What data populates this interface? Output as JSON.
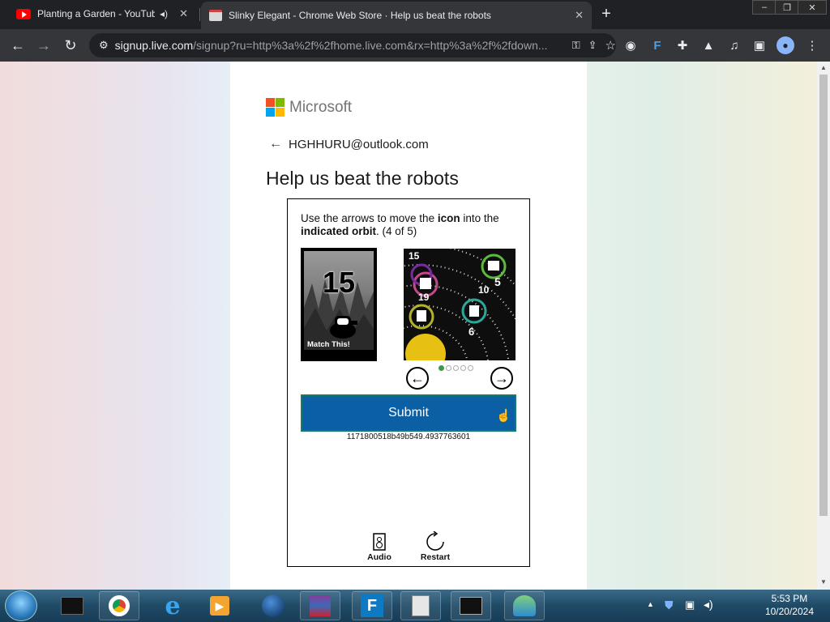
{
  "browser": {
    "tabs": [
      {
        "title": "Planting a Garden - YouTube",
        "audio": true
      },
      {
        "title": "Slinky Elegant - Chrome Web Store · Help us beat the robots",
        "active": true
      }
    ],
    "new_tab_symbol": "+",
    "url_domain": "signup.live.com",
    "url_rest": "/signup?ru=http%3a%2f%2fhome.live.com&rx=http%3a%2f%2fdown..."
  },
  "page": {
    "brand": "Microsoft",
    "email": "HGHHURU@outlook.com",
    "heading": "Help us beat the robots",
    "captcha": {
      "instr_pre": "Use the arrows to move the ",
      "instr_bold1": "icon",
      "instr_mid": " into the ",
      "instr_bold2": "indicated orbit",
      "instr_post": ". (4 of 5)",
      "match_number": "15",
      "match_label": "Match This!",
      "orbit_numbers": [
        "15",
        "19",
        "10",
        "5",
        "6"
      ],
      "dots_total": 5,
      "dots_active": 1,
      "submit_label": "Submit",
      "session_id": "1171800518b49b549.4937763601",
      "audio_label": "Audio",
      "restart_label": "Restart"
    }
  },
  "taskbar": {
    "time": "5:53 PM",
    "date": "10/20/2024"
  },
  "colors": {
    "submit_bg": "#0b5fa5",
    "ms_red": "#f25022",
    "ms_green": "#7fba00",
    "ms_blue": "#00a4ef",
    "ms_yellow": "#ffb900"
  }
}
